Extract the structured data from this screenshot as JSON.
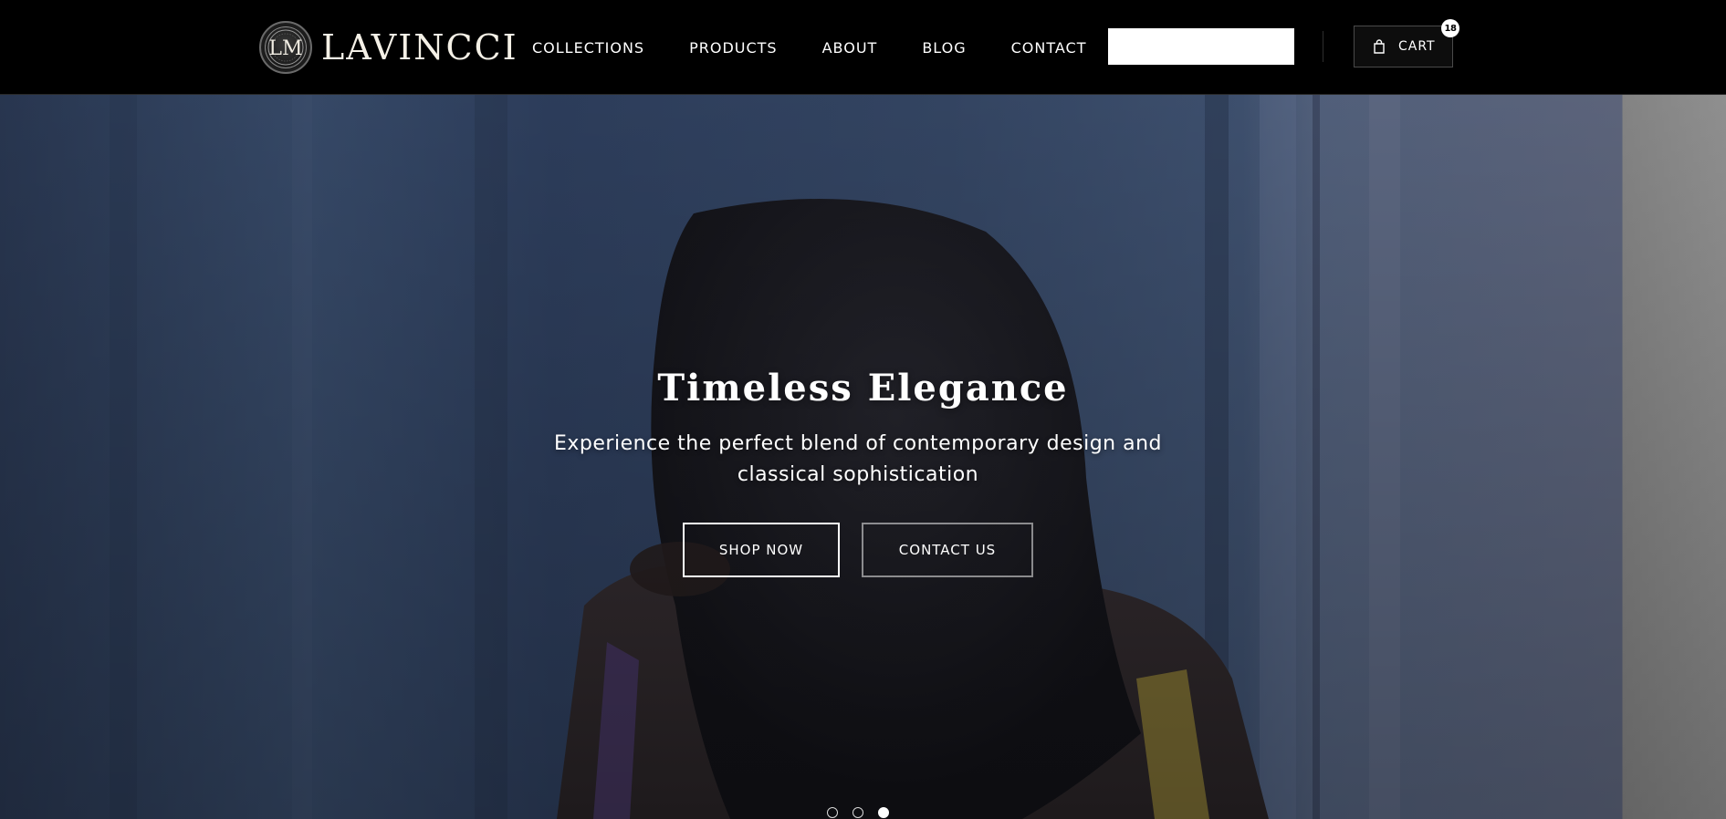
{
  "brand": {
    "name": "LAVINCCI",
    "monogram": "LM"
  },
  "nav": {
    "items": [
      {
        "label": "COLLECTIONS"
      },
      {
        "label": "PRODUCTS"
      },
      {
        "label": "ABOUT"
      },
      {
        "label": "BLOG"
      },
      {
        "label": "CONTACT"
      }
    ]
  },
  "search": {
    "value": "",
    "placeholder": ""
  },
  "cart": {
    "label": "CART",
    "count": "18",
    "icon": "shopping-bag-icon"
  },
  "hero": {
    "title": "Timeless Elegance",
    "subtitle": "Experience the perfect blend of contemporary design and classical sophistication",
    "primary_button": "SHOP NOW",
    "secondary_button": "CONTACT US",
    "slides": 3,
    "active_slide": 3
  },
  "colors": {
    "header_bg": "#000000",
    "text": "#ffffff",
    "hero_tint": "#3b4c6b"
  }
}
